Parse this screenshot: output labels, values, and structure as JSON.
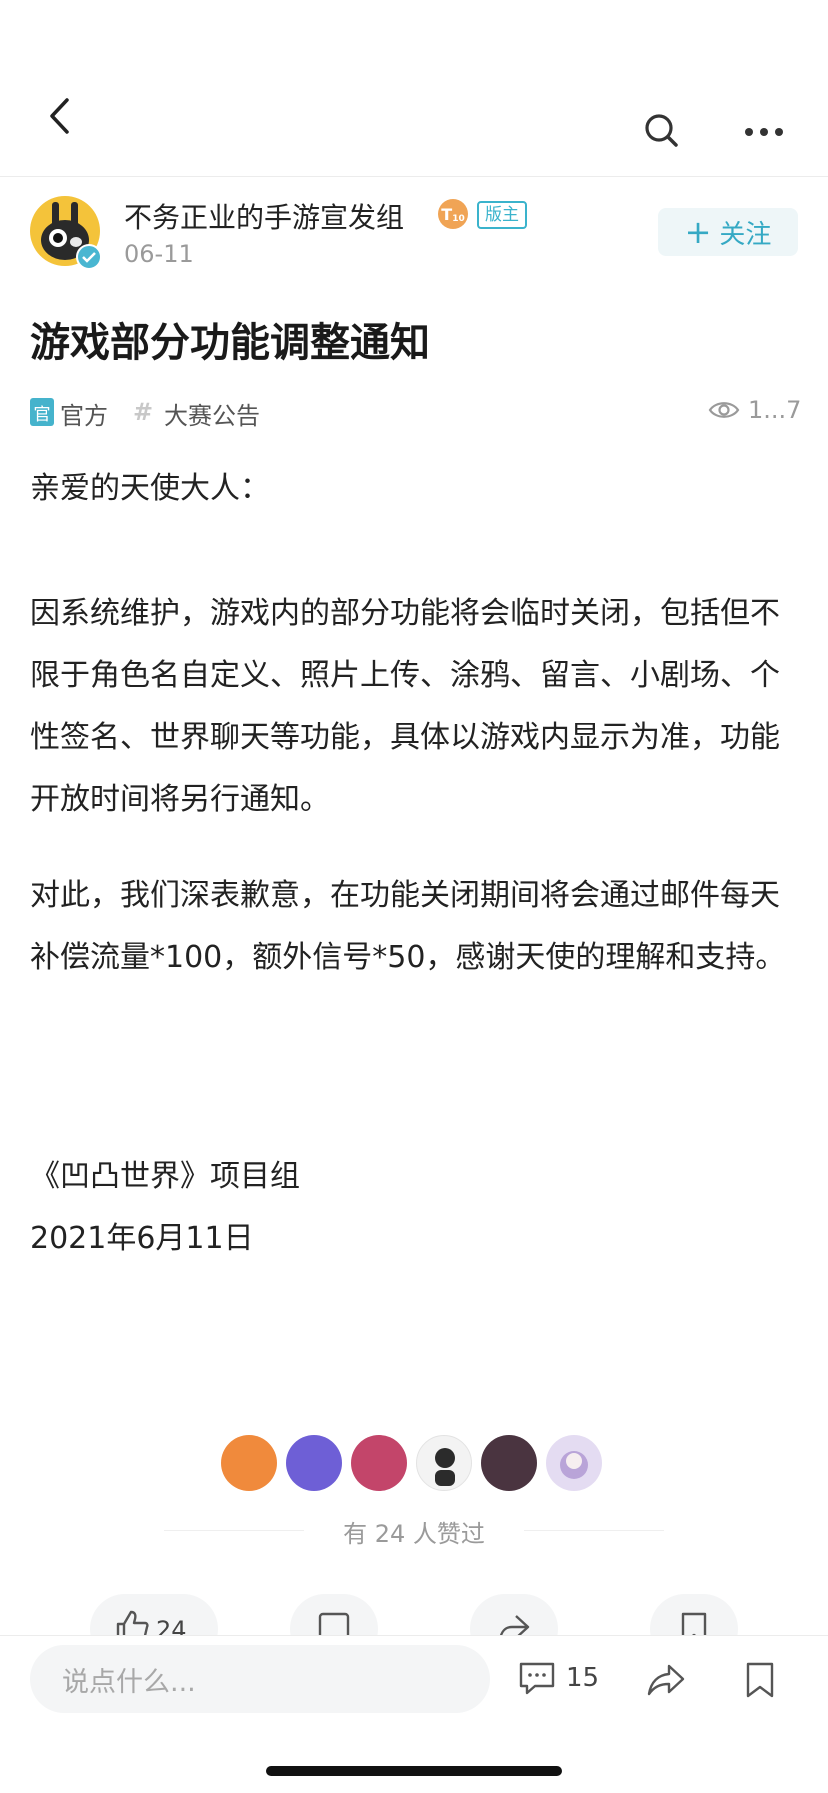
{
  "nav": {
    "back_icon": "chevron-left-icon",
    "search_icon": "search-icon",
    "more_icon": "more-horizontal-icon"
  },
  "author": {
    "name": "不务正业的手游宣发组",
    "level_badge": "T",
    "level_sub": "10",
    "moderator_badge": "版主",
    "date": "06-11",
    "follow_label": "关注"
  },
  "post": {
    "title": "游戏部分功能调整通知",
    "tags": {
      "official_icon": "官",
      "official": "官方",
      "topic": "大赛公告"
    },
    "views": "1...7",
    "greeting": "亲爱的天使大人：",
    "paragraph1": "因系统维护，游戏内的部分功能将会临时关闭，包括但不限于角色名自定义、照片上传、涂鸦、留言、小剧场、个性签名、世界聊天等功能，具体以游戏内显示为准，功能开放时间将另行通知。",
    "paragraph2": "对此，我们深表歉意，在功能关闭期间将会通过邮件每天补偿流量*100，额外信号*50，感谢天使的理解和支持。",
    "signature": "《凹凸世界》项目组",
    "signature_date": "2021年6月11日"
  },
  "likes": {
    "summary": "有 24 人赞过",
    "count_button": "24",
    "avatars": [
      "#f08a3c",
      "#6e5fd6",
      "#c3456a",
      "#2b2b2b",
      "#4a3440",
      "#b9a4d8"
    ]
  },
  "bottom": {
    "comment_placeholder": "说点什么...",
    "comment_count": "15"
  },
  "colors": {
    "accent": "#35a9c4",
    "text": "#222222",
    "muted": "#9a9a9a"
  }
}
